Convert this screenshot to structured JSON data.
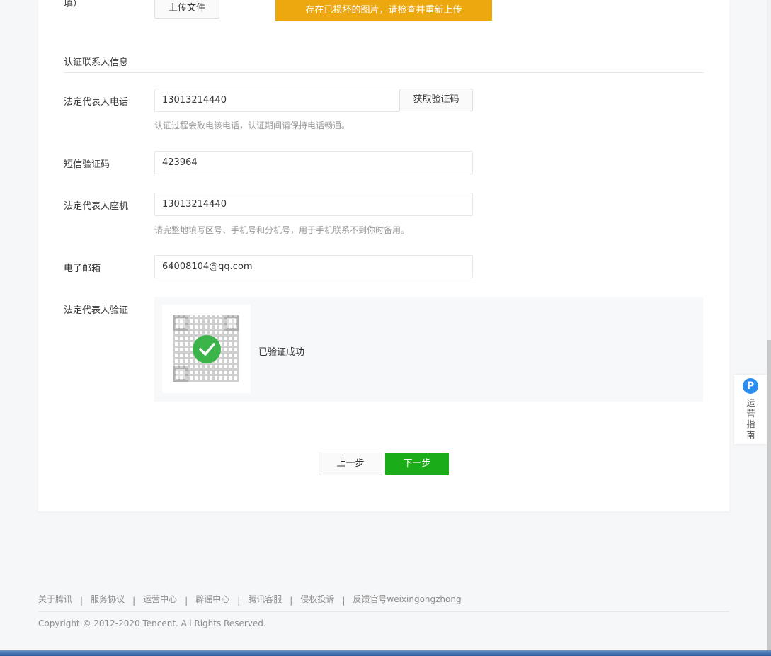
{
  "upload": {
    "field_label_tail": "填）",
    "button_label": "上传文件",
    "error_message": "存在已损坏的图片，请检查并重新上传"
  },
  "section": {
    "title": "认证联系人信息"
  },
  "phone": {
    "label": "法定代表人电话",
    "value": "13013214440",
    "code_button": "获取验证码",
    "hint": "认证过程会致电该电话，认证期间请保持电话畅通。"
  },
  "sms": {
    "label": "短信验证码",
    "value": "423964"
  },
  "landline": {
    "label": "法定代表人座机",
    "value": "13013214440",
    "hint": "请完整地填写区号、手机号和分机号，用于手机联系不到你时备用。"
  },
  "email": {
    "label": "电子邮箱",
    "value": "64008104@qq.com"
  },
  "verification": {
    "label": "法定代表人验证",
    "status_text": "已验证成功"
  },
  "actions": {
    "prev_label": "上一步",
    "next_label": "下一步"
  },
  "footer": {
    "links": [
      "关于腾讯",
      "服务协议",
      "运营中心",
      "辟谣中心",
      "腾讯客服",
      "侵权投诉",
      "反馈官号weixingongzhong"
    ],
    "separator": "|",
    "copyright": "Copyright © 2012-2020 Tencent. All Rights Reserved."
  },
  "side_widget": {
    "icon_letter": "P",
    "label": "运营指南"
  },
  "colors": {
    "primary_green": "#1aad19",
    "warning_orange": "#eca80e",
    "success_green": "#3bb44a",
    "widget_blue": "#2a8ef0"
  },
  "icons": [
    "check-circle-icon",
    "qr-code-icon",
    "operations-guide-icon"
  ]
}
